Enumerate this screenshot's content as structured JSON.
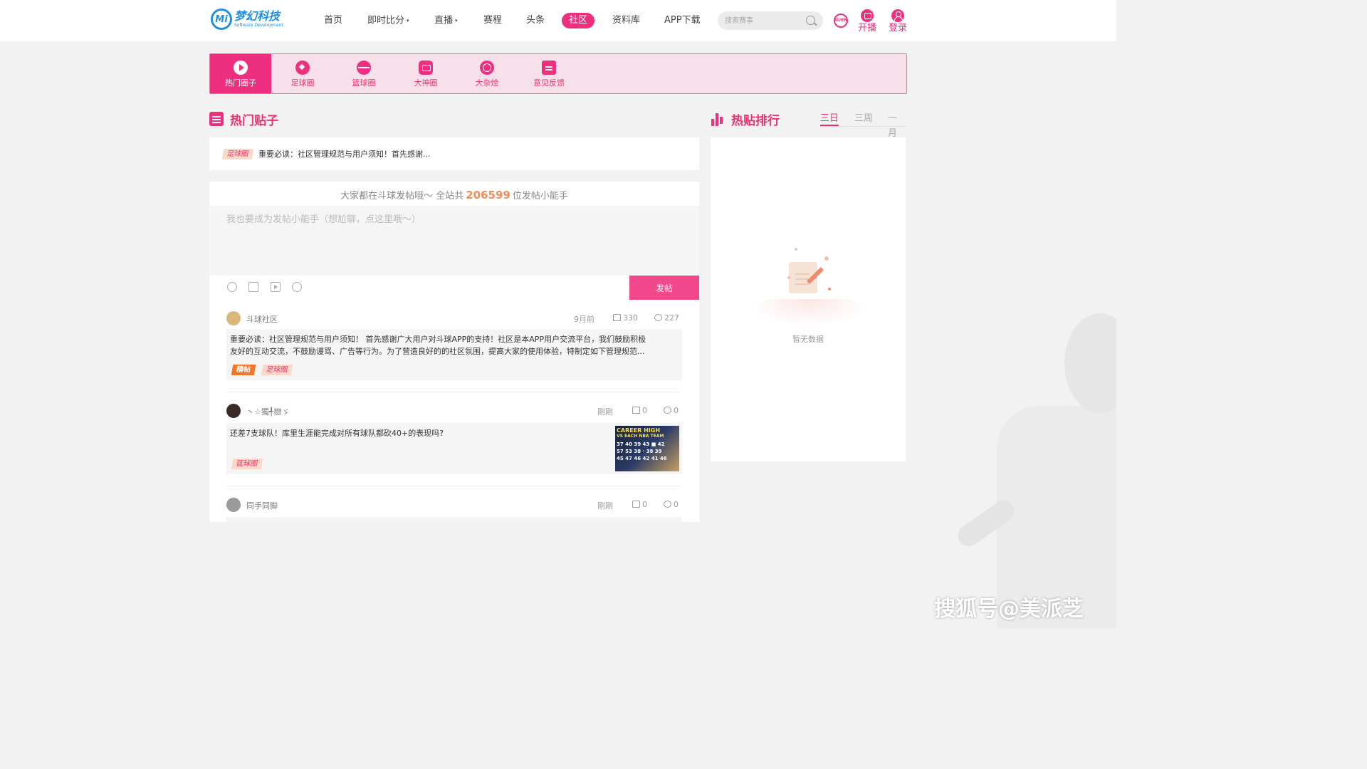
{
  "colors": {
    "accent": "#ee2f7f",
    "brand_blue": "#1f8fe0",
    "tag_bg": "#fbd9c9",
    "hot_tag": "#f0762b"
  },
  "header": {
    "logo_badge": "Mi",
    "logo_title": "梦幻科技",
    "logo_sub": "Software Development",
    "nav": [
      {
        "label": "首页",
        "has_caret": false
      },
      {
        "label": "即时比分",
        "has_caret": true
      },
      {
        "label": "直播",
        "has_caret": true
      },
      {
        "label": "赛程",
        "has_caret": false
      },
      {
        "label": "头条",
        "has_caret": false
      },
      {
        "label": "社区",
        "has_caret": false,
        "active": true
      },
      {
        "label": "资料库",
        "has_caret": false
      },
      {
        "label": "APP下载",
        "has_caret": false
      }
    ],
    "caret": "▾",
    "search_placeholder": "搜索赛事",
    "lang": "中/EN",
    "stream_label": "开播",
    "login_label": "登录"
  },
  "circles": [
    {
      "label": "热门圈子",
      "icon": "play-icon",
      "active": true
    },
    {
      "label": "足球圈",
      "icon": "football-icon"
    },
    {
      "label": "篮球圈",
      "icon": "basketball-icon"
    },
    {
      "label": "大神圈",
      "icon": "robot-icon"
    },
    {
      "label": "大杂烩",
      "icon": "mix-icon"
    },
    {
      "label": "意见反馈",
      "icon": "feedback-icon"
    }
  ],
  "hot_posts": {
    "title": "热门贴子",
    "pinned": {
      "tag": "足球圈",
      "text": "重要必读：社区管理规范与用户须知！首先感谢..."
    },
    "composer": {
      "stat_prefix": "大家都在斗球发帖哦～ 全站共",
      "stat_count": "206599",
      "stat_suffix": "位发帖小能手",
      "placeholder": "我也要成为发帖小能手（想尬聊，点这里哦～）",
      "tools": [
        "emoji-icon",
        "image-icon",
        "video-icon",
        "football-icon"
      ],
      "post_button": "发帖"
    },
    "posts": [
      {
        "author": "斗球社区",
        "time": "9月前",
        "likes": "330",
        "comments": "227",
        "text_lines": [
          "重要必读：社区管理规范与用户须知！ 首先感谢广大用户对斗球APP的支持！社区是本APP用户交流平台，我们鼓励积极",
          "友好的互动交流，不鼓励谩骂、广告等行为。为了营造良好的的社区氛围，提高大家的使用体验，特制定如下管理规范..."
        ],
        "tags": [
          "精帖",
          "足球圈"
        ]
      },
      {
        "author": "丶☆獨╃戀ゞ",
        "time": "刚刚",
        "likes": "0",
        "comments": "0",
        "text_lines": [
          "还差7支球队！库里生涯能完成对所有球队都砍40+的表现吗?"
        ],
        "tags": [
          "篮球圈"
        ],
        "thumb": {
          "title_line1": "CAREER HIGH",
          "title_line2": "VS EACH NBA TEAM",
          "rows": [
            "37 40 39 43 ■ 42",
            "57 53 38 · 38 39",
            "45 47 46 42 41 46"
          ]
        }
      },
      {
        "author": "同手同脚",
        "time": "刚刚",
        "likes": "0",
        "comments": "0"
      }
    ]
  },
  "ranking": {
    "title": "热贴排行",
    "ranges": [
      {
        "label": "三日",
        "active": true
      },
      {
        "label": "三周"
      },
      {
        "label": "一月"
      }
    ],
    "empty_text": "暂无数据"
  },
  "watermark": "搜狐号@美派芝"
}
